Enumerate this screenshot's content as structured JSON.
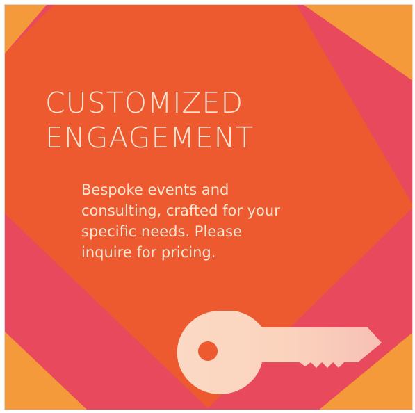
{
  "card": {
    "title_lines": [
      "CUSTOMIZED",
      "ENGAGEMENT"
    ],
    "description_lines": [
      "Bespoke events and",
      "consulting, crafted for your",
      "specific needs. Please",
      "inquire for pricing."
    ],
    "icon": "key-icon",
    "colors": {
      "corner_orange": "#f59a3a",
      "diamond_orange": "#ee5a30",
      "band_pink": "#e8495c",
      "text_cream": "#fbe4d2",
      "key_cream": "#fbd3bd"
    }
  }
}
